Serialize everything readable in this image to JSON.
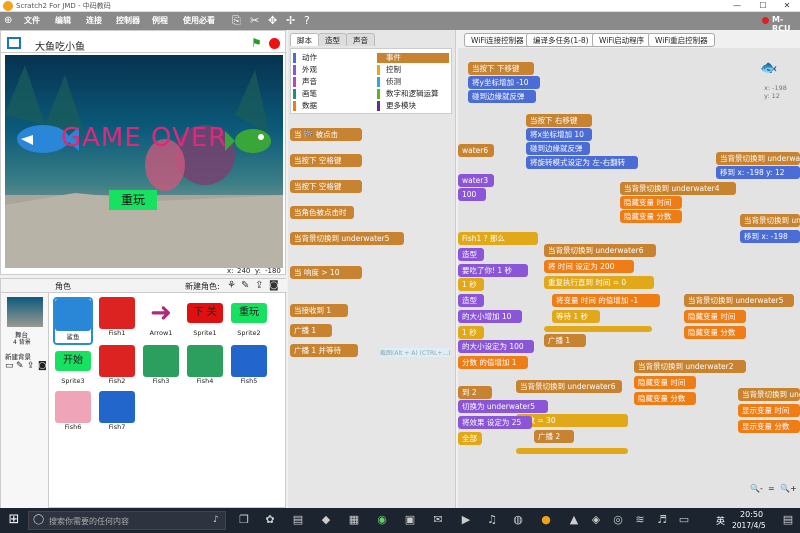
{
  "window": {
    "title": "Scratch2 For JMD - 中码教码"
  },
  "menu": [
    "文件",
    "编辑",
    "连接",
    "控制器",
    "例程",
    "使用必看"
  ],
  "menu_right": "M-RCU",
  "project": {
    "title": "大鱼吃小鱼",
    "coords_x": "240",
    "coords_y": "-180",
    "x_label": "x:",
    "y_label": "y:"
  },
  "stage_overlay": {
    "game_over": "GAME  OVER",
    "replay": "重玩"
  },
  "sprite_panel": {
    "label": "角色",
    "new_sprite": "新建角色:",
    "stage_label": "舞台",
    "stage_backdrops": "4 背景",
    "new_backdrop": "新建背景"
  },
  "sprites": [
    {
      "name": "鲨鱼",
      "selected": true
    },
    {
      "name": "Fish1"
    },
    {
      "name": "Arrow1"
    },
    {
      "name": "Sprite1",
      "text": "下 关"
    },
    {
      "name": "Sprite2",
      "text": "重玩"
    },
    {
      "name": "Sprite3",
      "text": "开始"
    },
    {
      "name": "Fish2"
    },
    {
      "name": "Fish3"
    },
    {
      "name": "Fish4"
    },
    {
      "name": "Fish5"
    },
    {
      "name": "Fish6"
    },
    {
      "name": "Fish7"
    }
  ],
  "tabs": [
    "脚本",
    "造型",
    "声音"
  ],
  "categories_left": [
    "动作",
    "外观",
    "声音",
    "画笔",
    "数据"
  ],
  "categories_right": [
    "事件",
    "控制",
    "侦测",
    "数字和逻辑运算",
    "更多模块"
  ],
  "palette_blocks": [
    "当 🏁 被点击",
    "当按下 空格键",
    "当按下 空格键",
    "当角色被点击时",
    "当背景切换到 underwater5",
    "当 响度 > 10",
    "当接收到 1",
    "广播 1",
    "广播 1 并等待"
  ],
  "top_buttons": [
    "WiFi连接控制器",
    "编译多任务(1-8)",
    "WiFi启动程序",
    "WiFi重启控制器"
  ],
  "sprite_info": {
    "x": "x: -198",
    "y": "y: 12"
  },
  "zoom": [
    "🔍-",
    "=",
    "🔍+"
  ],
  "scripts_text": {
    "a1": "当按下 下移键",
    "a2": "将y坐标增加 -10",
    "a3": "碰到边缘就反弹",
    "b1": "当按下 右移键",
    "b2": "将x坐标增加 10",
    "b3": "碰到边缘就反弹",
    "b4": "将旋转模式设定为 左-右翻转",
    "c1": "当背景切换到 underwater4",
    "c2": "隐藏变量 时间",
    "c3": "隐藏变量 分数",
    "d1": "当背景切换到 underwater6",
    "d2": "将 时间 设定为 200",
    "d3": "重复执行直到 时间 = 0",
    "d4": "将变量 时间 的值增加 -1",
    "d5": "等待 1 秒",
    "d6": "广播 1",
    "e1": "当背景切换到 underwater5",
    "e2": "隐藏变量 时间",
    "e3": "隐藏变量 分数",
    "f1": "当背景切换到 underwater2",
    "f2": "隐藏变量 时间",
    "f3": "隐藏变量 分数",
    "g1": "当背景切换到 underwater6",
    "g2": "切换为 underwater5",
    "g3": "分数 = 30",
    "g4": "广播 2",
    "g5": "将效果 设定为 25",
    "h1": "当背景切换到 underwater",
    "h2": "移到 x: -198 y: 12",
    "i1": "当背景切换到 underwater",
    "i2": "移到 x: -198",
    "j1": "当背景切换到 underwater",
    "j2": "显示变量 时间",
    "j3": "显示变量 分数",
    "k1": "water6",
    "k2": "water3",
    "k3": "100",
    "k4": "Fish1 ? 那么",
    "k5": "造型",
    "k6": "要吃了你! 1 秒",
    "k7": "1 秒",
    "k8": "造型",
    "k9": "的大小增加 10",
    "k10": "1 秒",
    "k11": "的大小设定为 100",
    "k12": "分数 的值增加 1",
    "k13": "到 2",
    "k14": "全部",
    "k15": "将 特效增加",
    "watermark": "截图(Alt + A)  (CTRL+...)"
  },
  "taskbar": {
    "search_placeholder": "搜索你需要的任何内容",
    "time": "20:50",
    "date": "2017/4/5",
    "lang": "英"
  }
}
